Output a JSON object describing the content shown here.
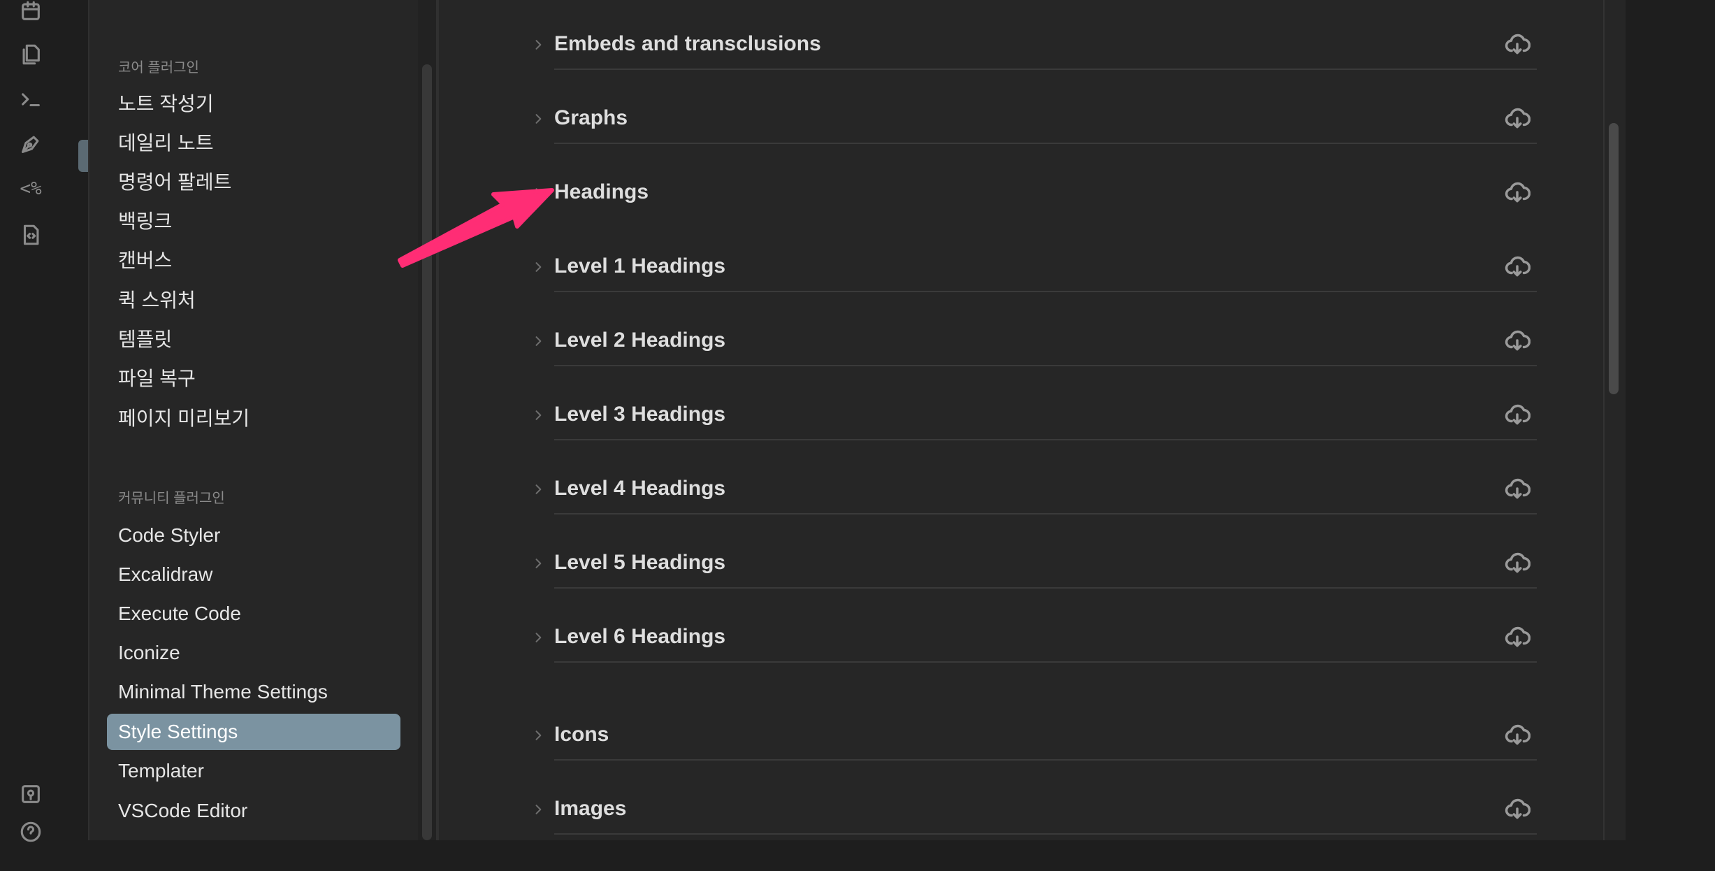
{
  "ribbon": {
    "icons": [
      "calendar-icon",
      "files-icon",
      "terminal-icon",
      "pen-tool-icon",
      "templater-icon",
      "file-code-icon",
      "map-pin-icon",
      "help-icon"
    ],
    "templater_glyph": "<%"
  },
  "sidebar": {
    "core_header": "코어 플러그인",
    "core_items": [
      "노트 작성기",
      "데일리 노트",
      "명령어 팔레트",
      "백링크",
      "캔버스",
      "퀵 스위처",
      "템플릿",
      "파일 복구",
      "페이지 미리보기"
    ],
    "community_header": "커뮤니티 플러그인",
    "community_items": [
      "Code Styler",
      "Excalidraw",
      "Execute Code",
      "Iconize",
      "Minimal Theme Settings",
      "Style Settings",
      "Templater",
      "VSCode Editor"
    ],
    "active_item": "Style Settings"
  },
  "main": {
    "sections": [
      "Embeds and transclusions",
      "Graphs",
      "Headings",
      "Level 1 Headings",
      "Level 2 Headings",
      "Level 3 Headings",
      "Level 4 Headings",
      "Level 5 Headings",
      "Level 6 Headings",
      "Icons",
      "Images"
    ]
  },
  "colors": {
    "accent_active": "#7b93a1",
    "arrow": "#ff2d75"
  }
}
